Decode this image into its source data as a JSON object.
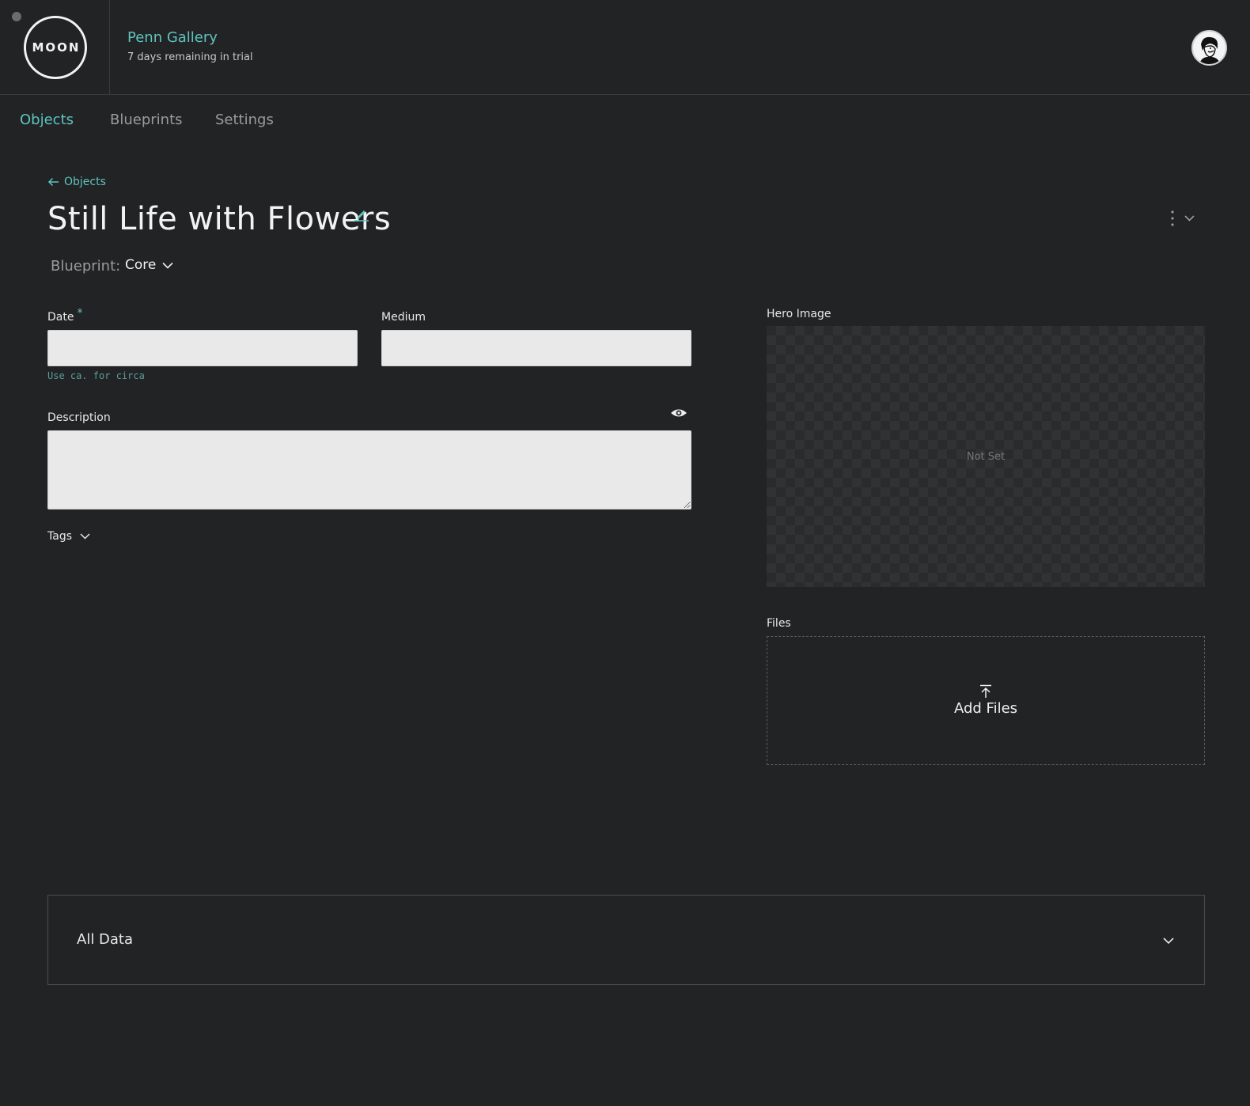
{
  "header": {
    "logo_text": "MOON",
    "org_name": "Penn Gallery",
    "trial_text": "7 days remaining in trial"
  },
  "nav": {
    "tabs": [
      {
        "label": "Objects",
        "active": true
      },
      {
        "label": "Blueprints",
        "active": false
      },
      {
        "label": "Settings",
        "active": false
      }
    ]
  },
  "breadcrumb": {
    "back_label": "Objects"
  },
  "object": {
    "title": "Still Life with Flowers",
    "blueprint_label": "Blueprint:",
    "blueprint_value": "Core"
  },
  "form": {
    "date": {
      "label": "Date",
      "required_mark": "*",
      "value": "",
      "hint": "Use ca. for circa"
    },
    "medium": {
      "label": "Medium",
      "value": ""
    },
    "description": {
      "label": "Description",
      "value": ""
    },
    "tags_label": "Tags"
  },
  "media": {
    "hero_label": "Hero Image",
    "hero_status": "Not Set",
    "files_label": "Files",
    "add_files_label": "Add Files"
  },
  "all_data": {
    "label": "All Data"
  },
  "colors": {
    "background": "#222325",
    "accent": "#5ec4bf",
    "input_bg": "#e8e9e8"
  }
}
